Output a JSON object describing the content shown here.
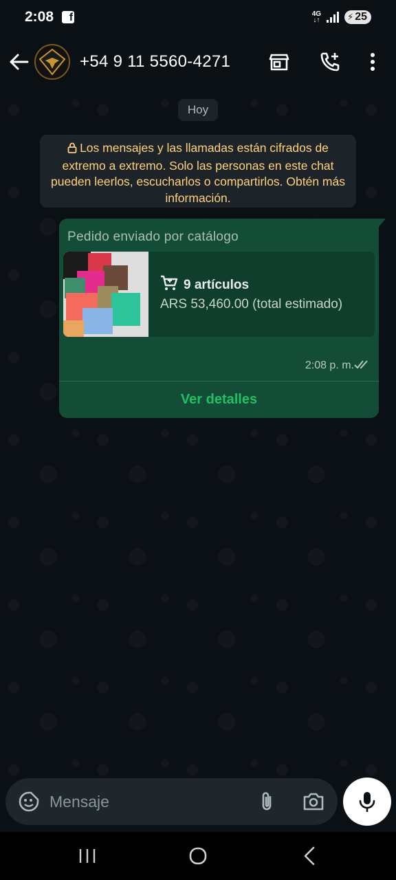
{
  "status_bar": {
    "time": "2:08",
    "network": "4G",
    "battery": "25"
  },
  "header": {
    "contact": "+54 9 11 5560-4271",
    "avatar_text": "Cristal"
  },
  "chat": {
    "date_chip": "Hoy",
    "encryption_notice": "Los mensajes y las llamadas están cifrados de extremo a extremo. Solo las personas en este chat pueden leerlos, escucharlos o compartirlos. Obtén más información.",
    "order": {
      "title": "Pedido enviado por catálogo",
      "item_count": "9 artículos",
      "total": "ARS 53,460.00 (total estimado)",
      "time": "2:08 p. m.",
      "action": "Ver detalles"
    }
  },
  "composer": {
    "placeholder": "Mensaje"
  },
  "colors": {
    "bubble": "#144d37",
    "accent": "#21c063",
    "notice_text": "#ffd279"
  },
  "icons": [
    "back-arrow-icon",
    "store-icon",
    "add-call-icon",
    "more-vert-icon",
    "lock-icon",
    "cart-icon",
    "double-check-icon",
    "sticker-icon",
    "attach-icon",
    "camera-icon",
    "mic-icon",
    "recents-icon",
    "home-icon",
    "nav-back-icon"
  ]
}
